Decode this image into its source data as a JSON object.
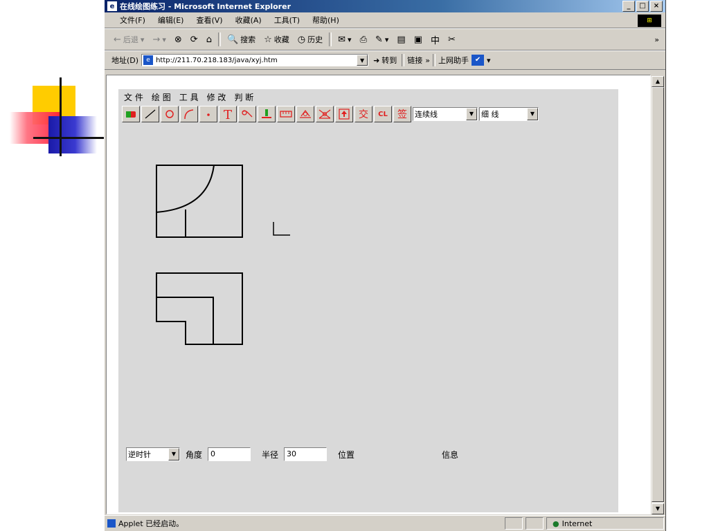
{
  "window": {
    "title": "在线绘图练习 - Microsoft Internet Explorer",
    "buttons": {
      "minimize": "_",
      "maximize": "□",
      "close": "×"
    }
  },
  "menu": [
    "文件(F)",
    "编辑(E)",
    "查看(V)",
    "收藏(A)",
    "工具(T)",
    "帮助(H)"
  ],
  "toolbar": {
    "back": "后退",
    "search": "搜索",
    "favorites": "收藏",
    "history": "历史",
    "more": "»"
  },
  "address": {
    "label": "地址(D)",
    "url": "http://211.70.218.183/java/xyj.htm",
    "go": "转到",
    "links": "链接",
    "links_more": "»",
    "helper": "上网助手"
  },
  "applet": {
    "menu": [
      "文",
      "件",
      "绘",
      "图",
      "工",
      "具",
      "修",
      "改",
      "判",
      "断"
    ],
    "tools": [
      {
        "name": "draw-tool-button",
        "glyph": "✎"
      },
      {
        "name": "line-tool-button",
        "glyph": "line"
      },
      {
        "name": "circle-tool-button",
        "glyph": "○"
      },
      {
        "name": "arc-tool-button",
        "glyph": "arc"
      },
      {
        "name": "point-tool-button",
        "glyph": "·"
      },
      {
        "name": "text-tool-button",
        "glyph": "T"
      },
      {
        "name": "ellipse-tool-button",
        "glyph": "ellipse"
      },
      {
        "name": "pen-tool-button",
        "glyph": "pen"
      },
      {
        "name": "ruler-tool-button",
        "glyph": "ruler"
      },
      {
        "name": "tangent-tool-button",
        "glyph": "tan"
      },
      {
        "name": "intersect-tool-button",
        "glyph": "cross"
      },
      {
        "name": "lift-tool-button",
        "glyph": "lift"
      },
      {
        "name": "cross-tool-button",
        "glyph": "交"
      },
      {
        "name": "cl-tool-button",
        "glyph": "CL"
      },
      {
        "name": "sign-tool-button",
        "glyph": "签"
      }
    ],
    "line_type": "连续线",
    "line_width": "细 线",
    "direction": "逆时针",
    "angle_label": "角度",
    "angle_value": "0",
    "radius_label": "半径",
    "radius_value": "30",
    "position_label": "位置",
    "info_label": "信息"
  },
  "status": {
    "text": "Applet 已经启动。",
    "zone": "Internet"
  }
}
